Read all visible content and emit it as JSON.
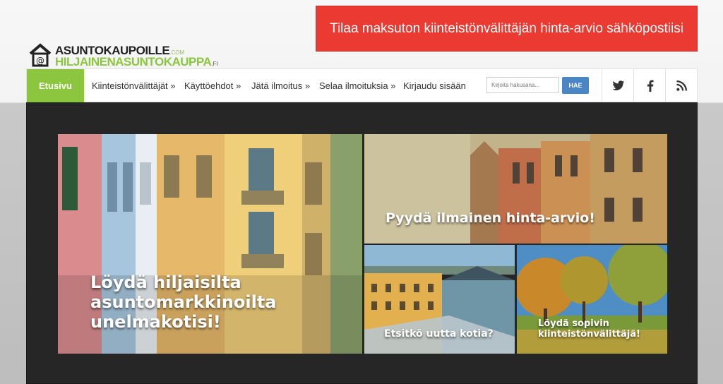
{
  "header": {
    "logo_line1": "ASUNTOKAUPOILLE",
    "logo_line1_suffix": ".COM",
    "logo_line2": "HILJAINENASUNTOKAUPPA",
    "logo_line2_suffix": ".FI",
    "cta_label": "Tilaa maksuton kiinteistönvälittäjän hinta-arvio sähköpostiisi"
  },
  "nav": {
    "home": "Etusivu",
    "items": [
      "Kiinteistönvälittäjät »",
      "Käyttöehdot »",
      "Jätä ilmoitus »",
      "Selaa ilmoituksia »",
      "Kirjaudu sisään"
    ]
  },
  "search": {
    "placeholder": "Kirjoita hakusana...",
    "button": "HAE"
  },
  "tiles": {
    "main_line1": "Löydä hiljaisilta",
    "main_line2": "asuntomarkkinoilta",
    "main_line3": "unelmakotisi!",
    "price": "Pyydä ilmainen hinta-arvio!",
    "new_home": "Etsitkö uutta kotia?",
    "agent_line1": "Löydä sopivin",
    "agent_line2": "kiinteistönvälittäjä!"
  },
  "colors": {
    "accent_green": "#8cc63f",
    "cta_red": "#ea3a32",
    "search_blue": "#4a86c5"
  }
}
